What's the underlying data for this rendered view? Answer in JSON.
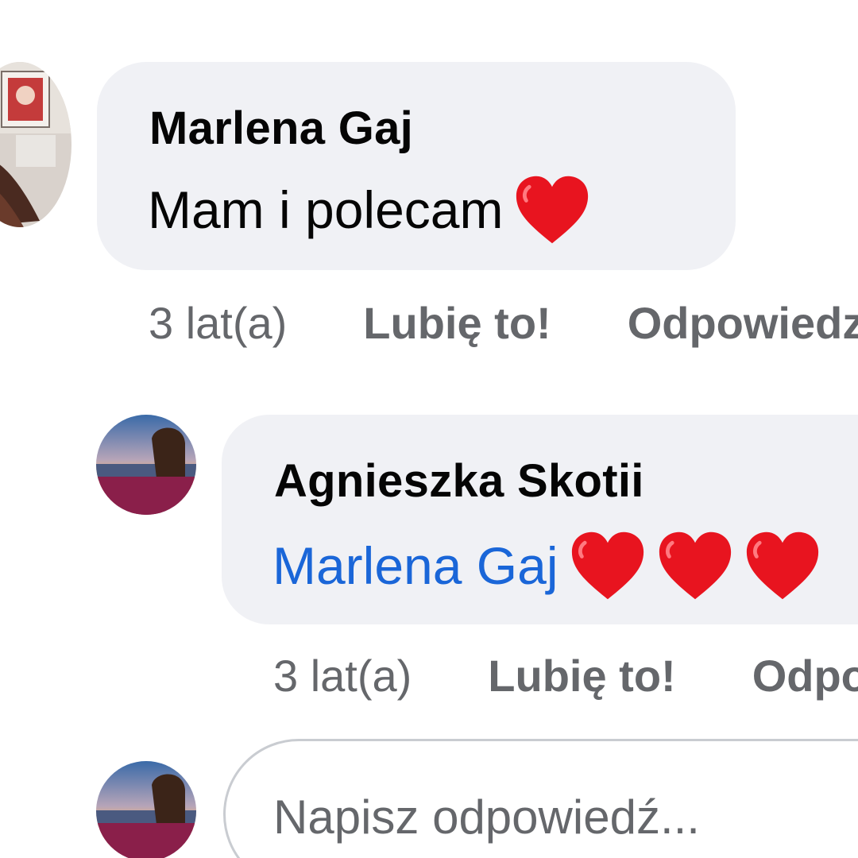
{
  "comments": [
    {
      "author": "Marlena Gaj",
      "text": "Mam i polecam",
      "emoji": [
        "heart-emoji"
      ],
      "time": "3 lat(a)",
      "like_label": "Lubię to!",
      "reply_label": "Odpowiedz"
    },
    {
      "author": "Agnieszka Skotii",
      "mention": "Marlena Gaj",
      "emoji": [
        "heart-emoji",
        "heart-emoji",
        "heart-emoji"
      ],
      "time": "3 lat(a)",
      "like_label": "Lubię to!",
      "reply_label": "Odpowiedz"
    }
  ],
  "reply_input": {
    "placeholder": "Napisz odpowiedź..."
  },
  "colors": {
    "bubble_bg": "#f0f1f5",
    "mention": "#1a66d8",
    "meta_text": "#65676b",
    "heart": "#e8141f"
  }
}
